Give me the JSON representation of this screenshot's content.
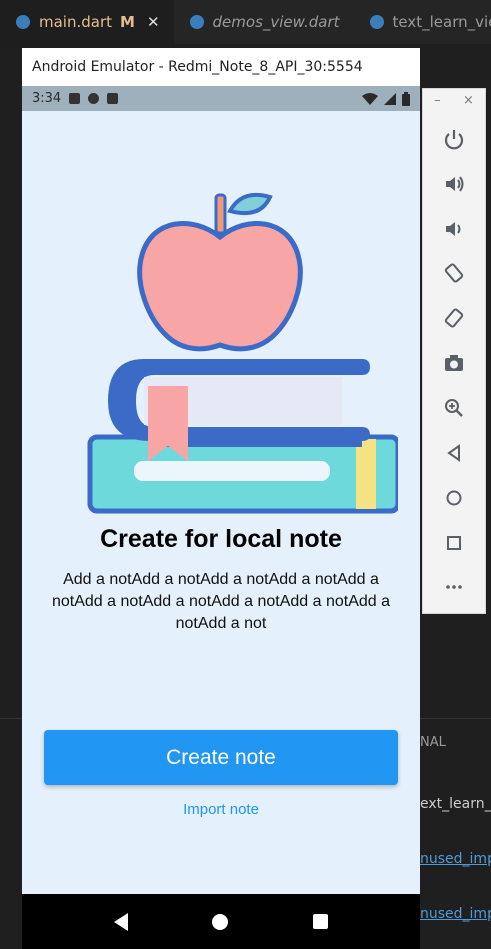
{
  "editor": {
    "tabs": [
      {
        "label": "main.dart",
        "modified": "M",
        "close": "✕"
      },
      {
        "label": "demos_view.dart"
      },
      {
        "label": "text_learn_vie"
      }
    ],
    "panel_tab": "NAL",
    "bg_lines": [
      "ext_learn_",
      "nused_imp",
      "nused_imp"
    ]
  },
  "emulator": {
    "title": "Android Emulator - Redmi_Note_8_API_30:5554",
    "status": {
      "time": "3:34"
    }
  },
  "app": {
    "heading": "Create for local note",
    "description": "Add a notAdd a notAdd a notAdd a notAdd a notAdd a notAdd a notAdd a notAdd a notAdd a notAdd a not",
    "create_button": "Create note",
    "import_link": "Import note"
  },
  "toolbar": {
    "minimize": "–",
    "close": "×",
    "icons": [
      "power-icon",
      "volume-up-icon",
      "volume-down-icon",
      "rotate-left-icon",
      "rotate-right-icon",
      "camera-icon",
      "zoom-icon",
      "back-icon",
      "home-icon",
      "overview-icon",
      "more-icon"
    ]
  },
  "colors": {
    "accent": "#2196f3",
    "screen_bg": "#e4f1fc",
    "apple": "#f8a5a5",
    "book_outline": "#3b6bc7"
  }
}
